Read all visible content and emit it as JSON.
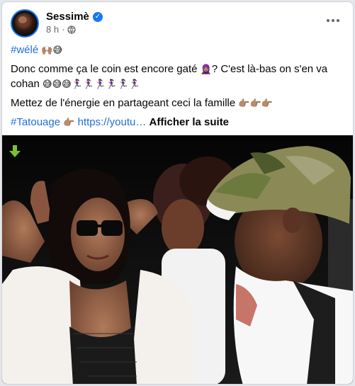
{
  "post": {
    "author": "Sessimè",
    "time": "8 h",
    "hashtag_line": "#wélé",
    "hashtag_emoji": "🙌🏽😅",
    "line1_text": "Donc comme ça le coin est encore gaté",
    "line1_emoji": "🧕🏽",
    "line1_text2": "?  C'est là-bas on s'en va cohan",
    "line1_emoji2": "😅😅😅🏃🏾‍♀️🏃🏾‍♀️🏃🏾‍♀️🏃🏾‍♀️🏃🏾‍♀️🏃🏾‍♀️",
    "line2_text": "Mettez de l'énergie en partageant ceci la famille",
    "line2_emoji": "👉🏽👉🏽👉🏽",
    "tag": "#Tatouage",
    "tag_emoji": "👉🏽",
    "link": "https://youtu…",
    "see_more": "Afficher la suite"
  },
  "icons": {
    "verified": "verified-badge-icon",
    "audience": "globe-icon",
    "menu": "more-options-icon",
    "download": "green-down-arrow-icon"
  },
  "colors": {
    "link": "#216fdb",
    "verified": "#1877f2",
    "secondary_text": "#65676b"
  }
}
